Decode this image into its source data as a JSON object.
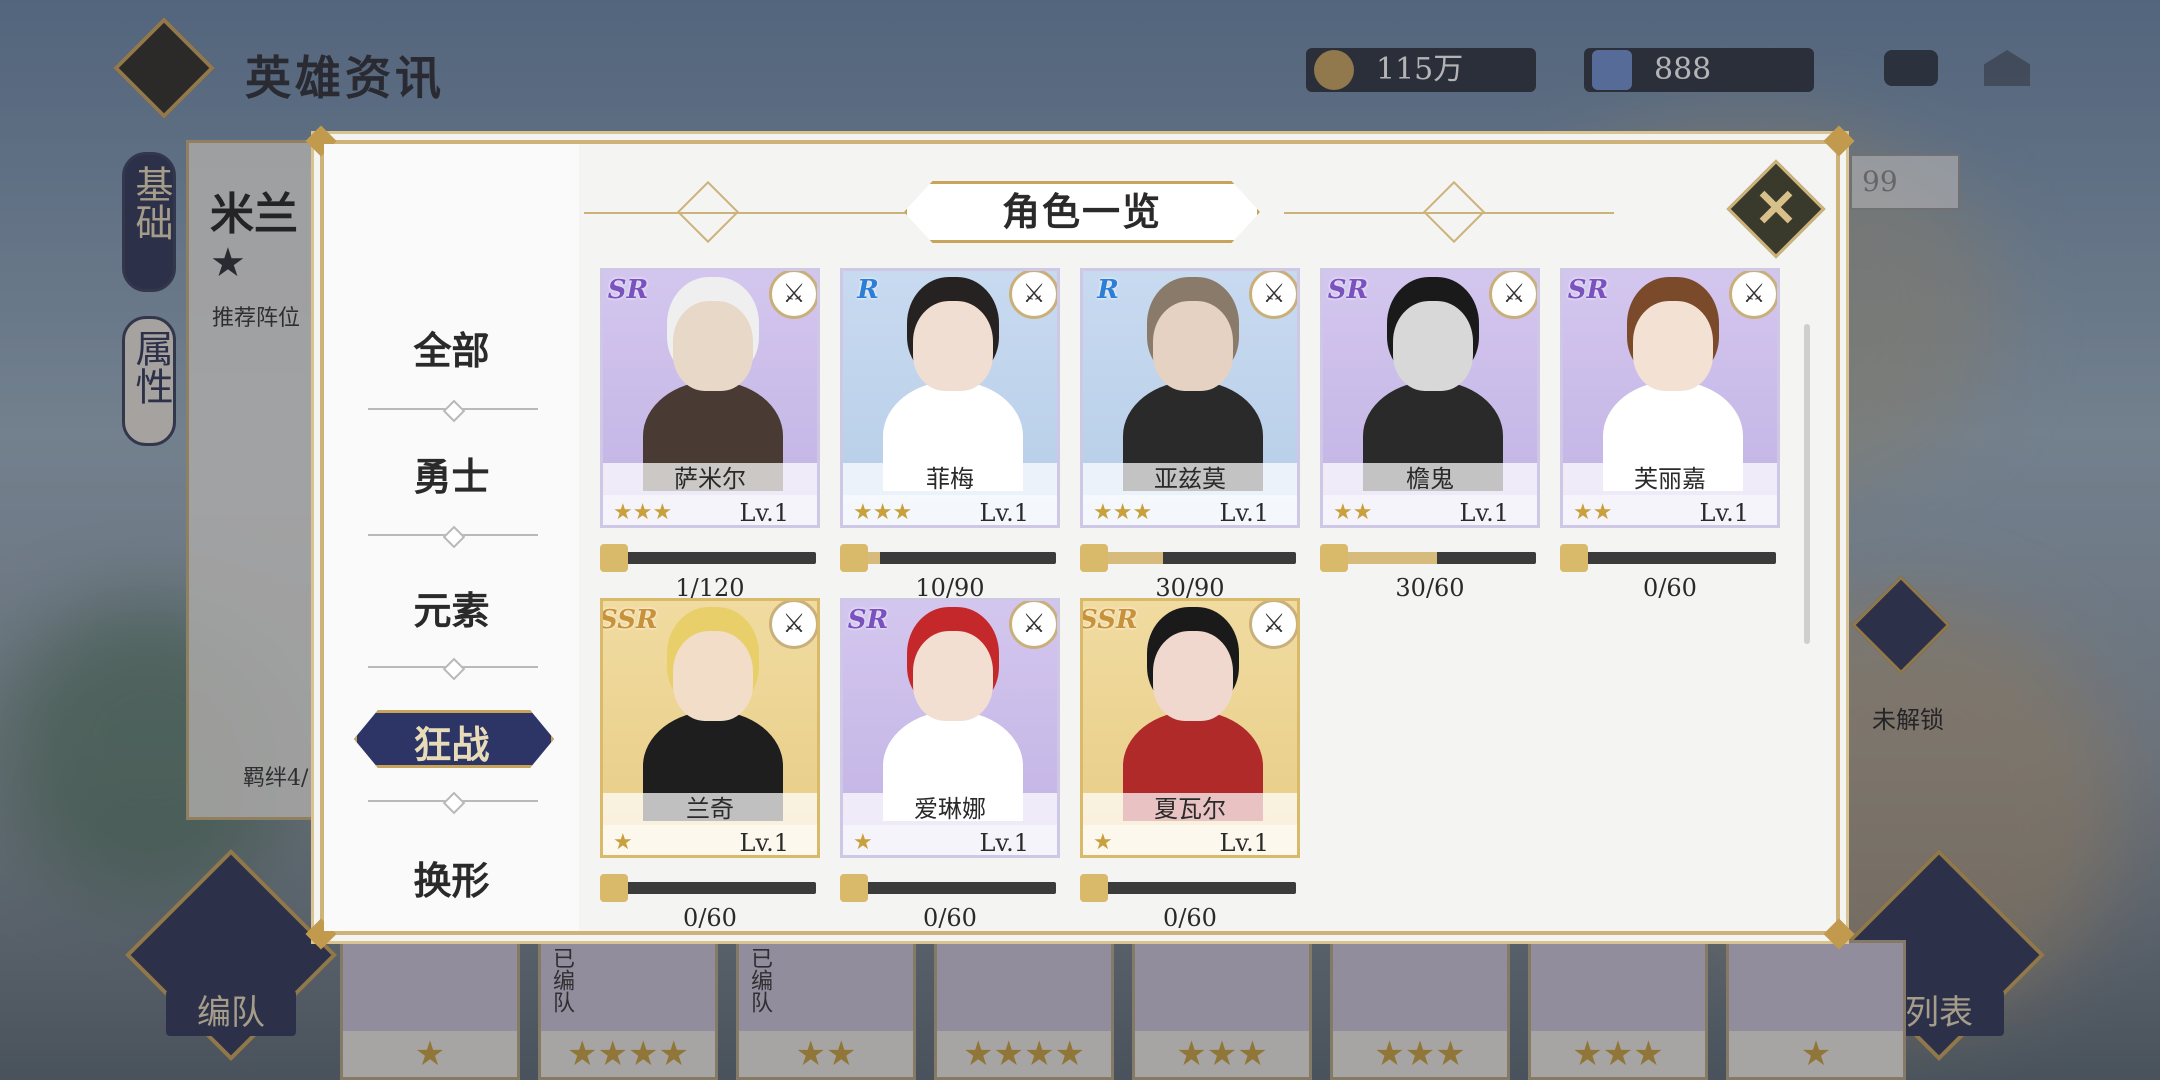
{
  "header": {
    "title": "英雄资讯"
  },
  "resources": [
    {
      "name": "gold",
      "value": "115万"
    },
    {
      "name": "diamond",
      "value": "888"
    }
  ],
  "background": {
    "hero_name": "米兰",
    "tabs": [
      "基础",
      "属性"
    ],
    "recommend_label": "推荐阵位",
    "bond_label": "羁绊4/",
    "locked_label": "未解锁",
    "level_input": "99",
    "bottom_buttons": {
      "team": "编队",
      "list": "列表"
    },
    "strip_cards": [
      {
        "tag": "",
        "stars": "★"
      },
      {
        "tag": "已编队",
        "stars": "★★★★"
      },
      {
        "tag": "已编队",
        "stars": "★★"
      },
      {
        "tag": "",
        "stars": "★★★★"
      },
      {
        "tag": "",
        "stars": "★★★"
      },
      {
        "tag": "",
        "stars": "★★★"
      },
      {
        "tag": "",
        "stars": "★★★"
      },
      {
        "tag": "",
        "stars": "★"
      }
    ]
  },
  "modal": {
    "title": "角色一览",
    "close_icon": "close-icon",
    "categories": [
      "全部",
      "勇士",
      "元素",
      "狂战",
      "换形"
    ],
    "active_category": "狂战",
    "heroes": [
      {
        "name": "萨米尔",
        "rarity": "SR",
        "stars": "★★★",
        "level": "Lv.1",
        "progress": "1/120",
        "fill": 0.008
      },
      {
        "name": "菲梅",
        "rarity": "R",
        "stars": "★★★",
        "level": "Lv.1",
        "progress": "10/90",
        "fill": 0.11
      },
      {
        "name": "亚兹莫",
        "rarity": "R",
        "stars": "★★★",
        "level": "Lv.1",
        "progress": "30/90",
        "fill": 0.33
      },
      {
        "name": "檐鬼",
        "rarity": "SR",
        "stars": "★★",
        "level": "Lv.1",
        "progress": "30/60",
        "fill": 0.5
      },
      {
        "name": "芙丽嘉",
        "rarity": "SR",
        "stars": "★★",
        "level": "Lv.1",
        "progress": "0/60",
        "fill": 0
      },
      {
        "name": "兰奇",
        "rarity": "SSR",
        "stars": "★",
        "level": "Lv.1",
        "progress": "0/60",
        "fill": 0
      },
      {
        "name": "爱琳娜",
        "rarity": "SR",
        "stars": "★",
        "level": "Lv.1",
        "progress": "0/60",
        "fill": 0
      },
      {
        "name": "夏瓦尔",
        "rarity": "SSR",
        "stars": "★",
        "level": "Lv.1",
        "progress": "0/60",
        "fill": 0
      }
    ]
  }
}
